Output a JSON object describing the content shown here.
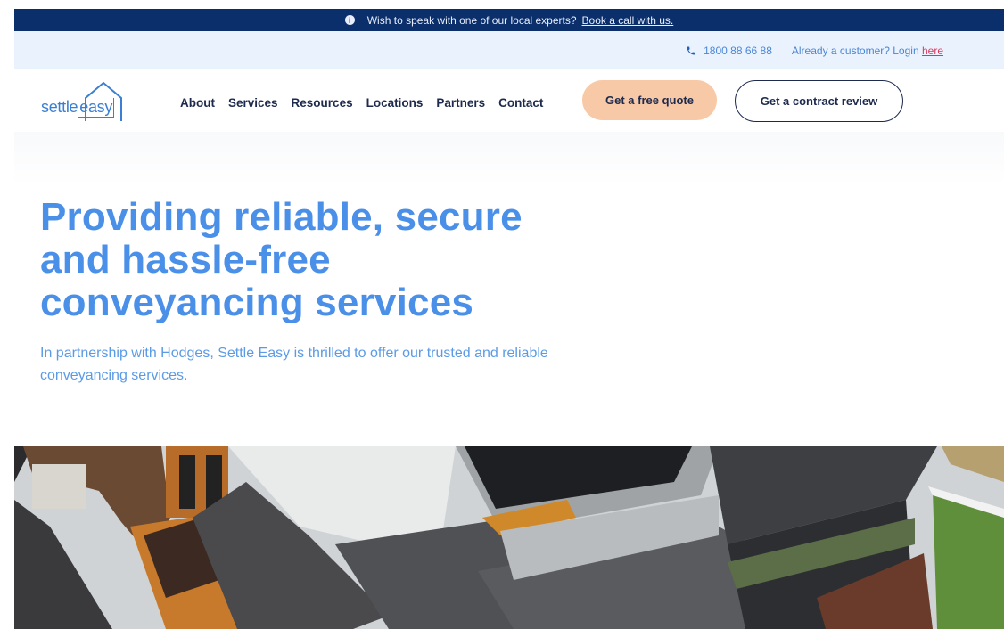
{
  "announcement": {
    "text": "Wish to speak with one of our local experts?",
    "link": "Book a call with us."
  },
  "subbar": {
    "phone": "1800 88 66 88",
    "login_prompt": "Already a customer? Login",
    "login_link": "here"
  },
  "header": {
    "logo_text_1": "settle",
    "logo_text_2": "easy",
    "nav": [
      "About",
      "Services",
      "Resources",
      "Locations",
      "Partners",
      "Contact"
    ],
    "quote_button": "Get a free quote",
    "review_button": "Get a contract review"
  },
  "hero": {
    "title": "Providing reliable, secure and hassle-free conveyancing services",
    "subtitle": "In partnership with Hodges, Settle Easy is thrilled to offer our trusted and reliable conveyancing services."
  },
  "colors": {
    "navy": "#0b2f6b",
    "light_blue_bar": "#eaf3fd",
    "brand_blue": "#4a8fe8",
    "quote_peach": "#f8c9a6",
    "login_pink": "#d9395e"
  },
  "icons": [
    "info-icon",
    "phone-icon",
    "house-logo-icon"
  ]
}
